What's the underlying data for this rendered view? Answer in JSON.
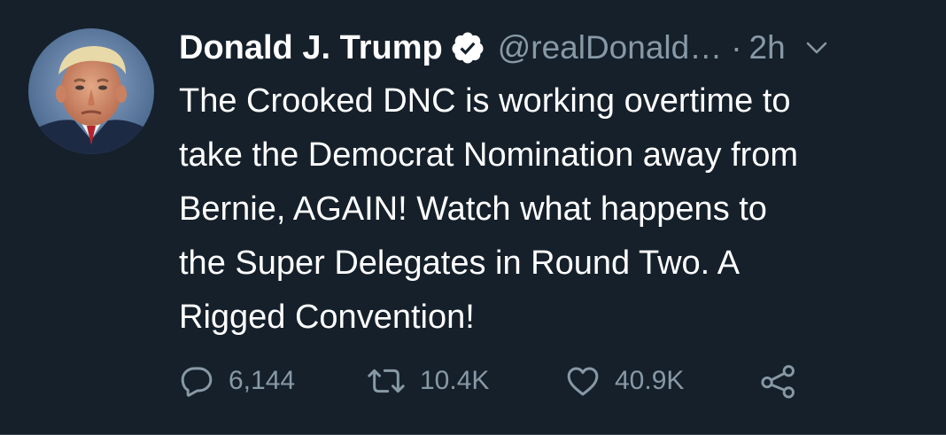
{
  "tweet": {
    "author": {
      "display_name": "Donald J. Trump",
      "handle": "@realDonald…",
      "verified": true,
      "avatar_icon": "profile-photo"
    },
    "separator": "·",
    "time": "2h",
    "text": "The Crooked DNC is working overtime to\ntake the Democrat Nomination away from\nBernie, AGAIN! Watch what happens to\nthe Super Delegates in Round Two. A\nRigged Convention!",
    "actions": {
      "reply": {
        "icon": "reply-icon",
        "count": "6,144"
      },
      "retweet": {
        "icon": "retweet-icon",
        "count": "10.4K"
      },
      "like": {
        "icon": "heart-icon",
        "count": "40.9K"
      },
      "share": {
        "icon": "share-icon"
      }
    }
  },
  "colors": {
    "background": "#15202b",
    "primary_text": "#ffffff",
    "secondary_text": "#8899a6",
    "verified_badge": "#ffffff"
  }
}
